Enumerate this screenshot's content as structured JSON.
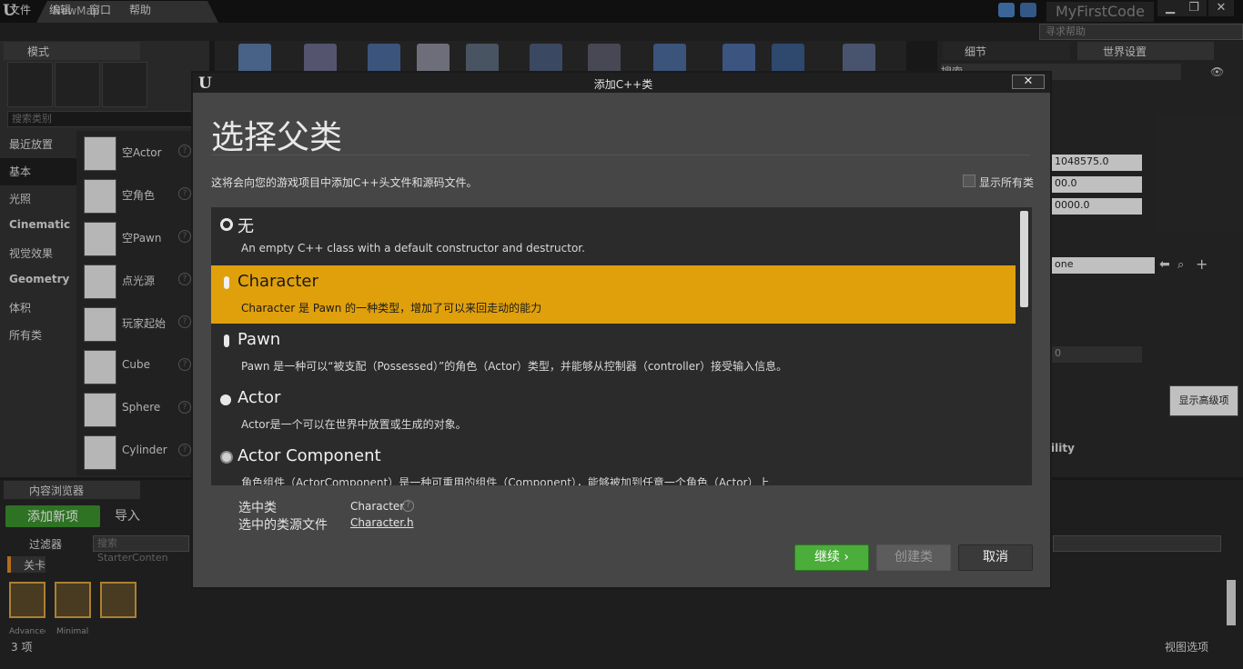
{
  "window": {
    "map_tab": "NewMap",
    "project_name": "MyFirstCode",
    "min_label": "▁",
    "max_label": "❐",
    "close_label": "✕"
  },
  "menu": {
    "items": [
      "文件",
      "编辑",
      "窗口",
      "帮助"
    ],
    "help_search_placeholder": "寻求帮助"
  },
  "modes": {
    "tab_label": "模式",
    "search_placeholder": "搜索类别",
    "categories": [
      {
        "label": "最近放置",
        "bold": false,
        "selected": false
      },
      {
        "label": "基本",
        "bold": false,
        "selected": true
      },
      {
        "label": "光照",
        "bold": false,
        "selected": false
      },
      {
        "label": "Cinematic",
        "bold": true,
        "selected": false
      },
      {
        "label": "视觉效果",
        "bold": false,
        "selected": false
      },
      {
        "label": "Geometry",
        "bold": true,
        "selected": false
      },
      {
        "label": "体积",
        "bold": false,
        "selected": false
      },
      {
        "label": "所有类",
        "bold": false,
        "selected": false
      }
    ],
    "placeables": [
      {
        "label": "空Actor",
        "icon": "sphere-icon"
      },
      {
        "label": "空角色",
        "icon": "character-icon"
      },
      {
        "label": "空Pawn",
        "icon": "pawn-icon"
      },
      {
        "label": "点光源",
        "icon": "lightbulb-icon"
      },
      {
        "label": "玩家起始",
        "icon": "flag-icon"
      },
      {
        "label": "Cube",
        "icon": "cube-icon"
      },
      {
        "label": "Sphere",
        "icon": "sphere-icon"
      },
      {
        "label": "Cylinder",
        "icon": "cylinder-icon"
      }
    ],
    "help_glyph": "?"
  },
  "right_panel": {
    "details_tab": "细节",
    "world_settings_tab": "世界设置",
    "search_placeholder": "搜索",
    "fields": [
      "1048575.0",
      "00.0",
      "0000.0"
    ],
    "dropdown_value": "one",
    "small_value": "0",
    "advanced_button": "显示高级项",
    "section_label": "ility"
  },
  "content_browser": {
    "tab_label": "内容浏览器",
    "add_new": "添加新项",
    "import": "导入",
    "filter": "过滤器",
    "search_placeholder": "搜索 StarterConten",
    "level_chip": "关卡",
    "asset_names": [
      "Advanced",
      "Minimal"
    ],
    "item_count": "3 项",
    "view_options": "视图选项"
  },
  "dialog": {
    "title": "添加C++类",
    "close": "✕",
    "heading": "选择父类",
    "description": "这将会向您的游戏项目中添加C++头文件和源码文件。",
    "show_all_label": "显示所有类",
    "classes": [
      {
        "name": "无",
        "desc": "An empty C++ class with a default constructor and destructor.",
        "icon": "none-circle-icon",
        "selected": false
      },
      {
        "name": "Character",
        "desc": "Character 是 Pawn 的一种类型，增加了可以来回走动的能力",
        "icon": "character-icon",
        "selected": true
      },
      {
        "name": "Pawn",
        "desc": "Pawn 是一种可以“被支配（Possessed）”的角色（Actor）类型，并能够从控制器（controller）接受输入信息。",
        "icon": "pawn-icon",
        "selected": false
      },
      {
        "name": "Actor",
        "desc": "Actor是一个可以在世界中放置或生成的对象。",
        "icon": "actor-sphere-icon",
        "selected": false
      },
      {
        "name": "Actor Component",
        "desc": "角色组件（ActorComponent）是一种可重用的组件（Component），能够被加到任意一个角色（Actor）上",
        "icon": "component-icon",
        "selected": false
      }
    ],
    "selected_class_label": "选中类",
    "selected_class_value": "Character",
    "source_file_label": "选中的类源文件",
    "source_file_value": "Character.h",
    "continue_button": "继续 ›",
    "create_button": "创建类",
    "cancel_button": "取消"
  },
  "colors": {
    "selection": "#e0a00c",
    "continue_green": "#4bad3a",
    "add_new_green": "#3a8f2c"
  }
}
